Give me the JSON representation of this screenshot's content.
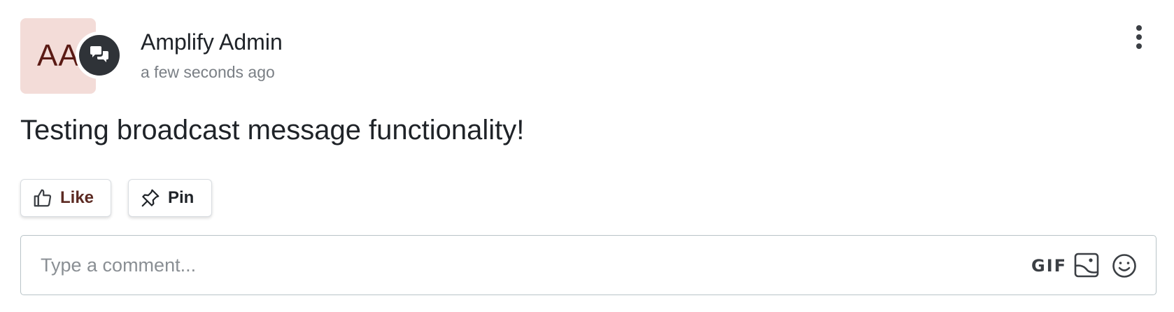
{
  "post": {
    "avatar_initials": "AA",
    "badge_icon": "chat-bubbles-icon",
    "author_name": "Amplify Admin",
    "timestamp": "a few seconds ago",
    "more_icon": "vertical-ellipsis-icon",
    "message": "Testing broadcast message functionality!"
  },
  "actions": {
    "like_label": "Like",
    "like_icon": "thumbs-up-icon",
    "pin_label": "Pin",
    "pin_icon": "pushpin-icon"
  },
  "comment": {
    "placeholder": "Type a comment...",
    "value": "",
    "gif_label": "GIF",
    "image_icon": "image-icon",
    "emoji_icon": "smiley-icon"
  },
  "colors": {
    "avatar_bg": "#f3dcd8",
    "avatar_text": "#5a1a14",
    "badge_bg": "#2f3338",
    "like_text": "#5c2a22",
    "border": "#b8c3c7"
  }
}
